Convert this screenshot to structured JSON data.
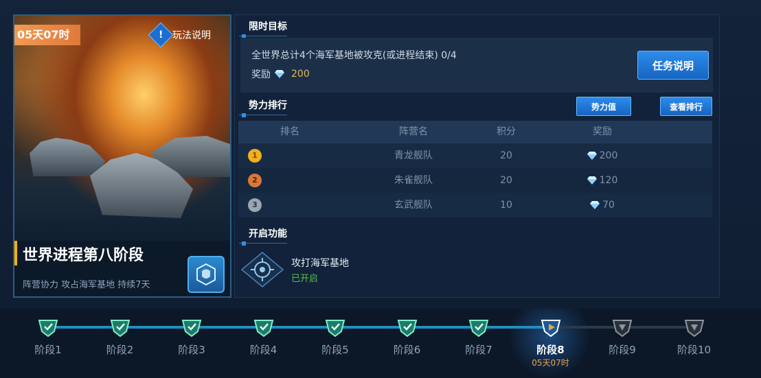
{
  "left_card": {
    "timer": "05天07时",
    "help_label": "玩法说明",
    "stage_title": "世界进程第八阶段",
    "stage_subtitle": "阵营协力 攻占海军基地 持续7天"
  },
  "goal": {
    "section_title": "限时目标",
    "description": "全世界总计4个海军基地被攻克(或进程结束) 0/4",
    "reward_label": "奖励",
    "reward_amount": "200",
    "task_button": "任务说明"
  },
  "ranking": {
    "section_title": "势力排行",
    "power_button": "势力值",
    "view_button": "查看排行",
    "headers": [
      "排名",
      "阵营名",
      "积分",
      "奖励"
    ],
    "rows": [
      {
        "rank": "1",
        "name": "青龙舰队",
        "score": "20",
        "reward": "200"
      },
      {
        "rank": "2",
        "name": "朱雀舰队",
        "score": "20",
        "reward": "120"
      },
      {
        "rank": "3",
        "name": "玄武舰队",
        "score": "10",
        "reward": "70"
      }
    ]
  },
  "feature": {
    "section_title": "开启功能",
    "name": "攻打海军基地",
    "status": "已开启"
  },
  "timeline": {
    "stages": [
      "阶段1",
      "阶段2",
      "阶段3",
      "阶段4",
      "阶段5",
      "阶段6",
      "阶段7",
      "阶段8",
      "阶段9",
      "阶段10"
    ],
    "current_index": 7,
    "current_timer": "05天07时"
  },
  "colors": {
    "accent_blue": "#2d8bea",
    "timer_orange": "#e0793a",
    "gold": "#e8b85a",
    "enabled_green": "#56c04a"
  }
}
